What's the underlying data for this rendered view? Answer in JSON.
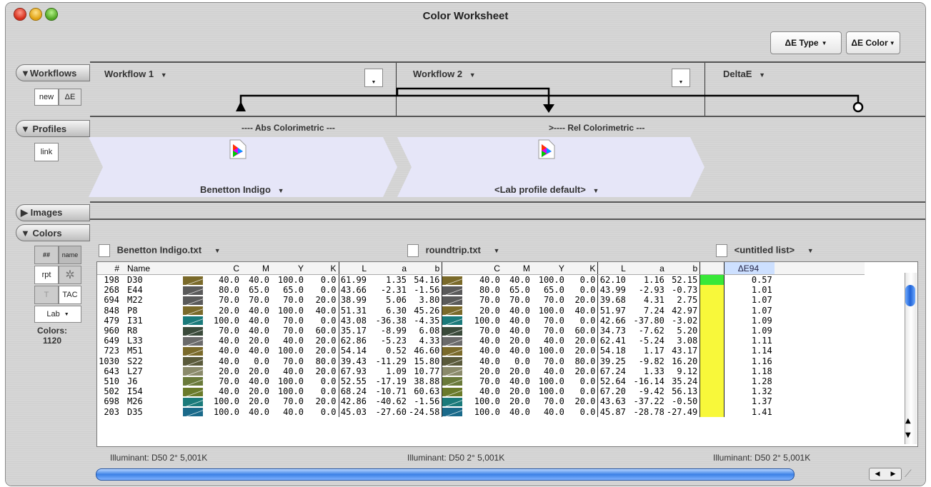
{
  "window": {
    "title": "Color Worksheet"
  },
  "toolbar": {
    "de_type": "ΔE Type",
    "de_color": "ΔE Color"
  },
  "sections": {
    "workflows": "▼Workflows",
    "profiles": "▼ Profiles",
    "images": "▶ Images",
    "colors": "▼ Colors"
  },
  "workflows": {
    "new_label": "new",
    "de_label": "ΔE",
    "w1": "Workflow 1",
    "w2": "Workflow 2",
    "w3": "DeltaE",
    "dropdown_glyph": "▼"
  },
  "profiles": {
    "link_label": "link",
    "intent1": "---- Abs Colorimetric ---",
    "intent2": ">---- Rel Colorimetric ---",
    "p1": "Benetton Indigo",
    "p2": "<Lab profile default>"
  },
  "colors_side": {
    "num_btn": "##",
    "name_btn": "name",
    "rpt_btn": "rpt",
    "t_btn": "T",
    "tac_btn": "TAC",
    "lab_btn": "Lab",
    "count_label": "Colors:",
    "count_value": "1120"
  },
  "lists": {
    "l1": "Benetton Indigo.txt",
    "l2": "roundtrip.txt",
    "l3": "<untitled list>"
  },
  "table": {
    "headers": [
      "#",
      "Name",
      "C",
      "M",
      "Y",
      "K",
      "L",
      "a",
      "b",
      "C",
      "M",
      "Y",
      "K",
      "L",
      "a",
      "b",
      "ΔE94"
    ],
    "swatch_colors": [
      "#7a6a2a",
      "#5a5a5a",
      "#5a5a5a",
      "#7a6a2a",
      "#1a7a7a",
      "#3a4a3a",
      "#6a6a6a",
      "#7a6a2a",
      "#5a5a3a",
      "#8a8a6a",
      "#6a7a3a",
      "#6a7a2a",
      "#1a7a7a",
      "#1a6a8a"
    ],
    "rows": [
      [
        "198",
        "D30",
        "40.0",
        "40.0",
        "100.0",
        "0.0",
        "61.99",
        "1.35",
        "54.16",
        "40.0",
        "40.0",
        "100.0",
        "0.0",
        "62.10",
        "1.16",
        "52.15",
        "0.57"
      ],
      [
        "268",
        "E44",
        "80.0",
        "65.0",
        "65.0",
        "0.0",
        "43.66",
        "-2.31",
        "-1.56",
        "80.0",
        "65.0",
        "65.0",
        "0.0",
        "43.99",
        "-2.93",
        "-0.73",
        "1.01"
      ],
      [
        "694",
        "M22",
        "70.0",
        "70.0",
        "70.0",
        "20.0",
        "38.99",
        "5.06",
        "3.80",
        "70.0",
        "70.0",
        "70.0",
        "20.0",
        "39.68",
        "4.31",
        "2.75",
        "1.07"
      ],
      [
        "848",
        "P8",
        "20.0",
        "40.0",
        "100.0",
        "40.0",
        "51.31",
        "6.30",
        "45.26",
        "20.0",
        "40.0",
        "100.0",
        "40.0",
        "51.97",
        "7.24",
        "42.97",
        "1.07"
      ],
      [
        "479",
        "I31",
        "100.0",
        "40.0",
        "70.0",
        "0.0",
        "43.08",
        "-36.38",
        "-4.35",
        "100.0",
        "40.0",
        "70.0",
        "0.0",
        "42.66",
        "-37.80",
        "-3.02",
        "1.09"
      ],
      [
        "960",
        "R8",
        "70.0",
        "40.0",
        "70.0",
        "60.0",
        "35.17",
        "-8.99",
        "6.08",
        "70.0",
        "40.0",
        "70.0",
        "60.0",
        "34.73",
        "-7.62",
        "5.20",
        "1.09"
      ],
      [
        "649",
        "L33",
        "40.0",
        "20.0",
        "40.0",
        "20.0",
        "62.86",
        "-5.23",
        "4.33",
        "40.0",
        "20.0",
        "40.0",
        "20.0",
        "62.41",
        "-5.24",
        "3.08",
        "1.11"
      ],
      [
        "723",
        "M51",
        "40.0",
        "40.0",
        "100.0",
        "20.0",
        "54.14",
        "0.52",
        "46.60",
        "40.0",
        "40.0",
        "100.0",
        "20.0",
        "54.18",
        "1.17",
        "43.17",
        "1.14"
      ],
      [
        "1030",
        "S22",
        "40.0",
        "0.0",
        "70.0",
        "80.0",
        "39.43",
        "-11.29",
        "15.80",
        "40.0",
        "0.0",
        "70.0",
        "80.0",
        "39.25",
        "-9.82",
        "16.20",
        "1.16"
      ],
      [
        "643",
        "L27",
        "20.0",
        "20.0",
        "40.0",
        "20.0",
        "67.93",
        "1.09",
        "10.77",
        "20.0",
        "20.0",
        "40.0",
        "20.0",
        "67.24",
        "1.33",
        "9.12",
        "1.18"
      ],
      [
        "510",
        "J6",
        "70.0",
        "40.0",
        "100.0",
        "0.0",
        "52.55",
        "-17.19",
        "38.88",
        "70.0",
        "40.0",
        "100.0",
        "0.0",
        "52.64",
        "-16.14",
        "35.24",
        "1.28"
      ],
      [
        "502",
        "I54",
        "40.0",
        "20.0",
        "100.0",
        "0.0",
        "68.24",
        "-10.71",
        "60.63",
        "40.0",
        "20.0",
        "100.0",
        "0.0",
        "67.20",
        "-9.42",
        "56.13",
        "1.32"
      ],
      [
        "698",
        "M26",
        "100.0",
        "20.0",
        "70.0",
        "20.0",
        "42.86",
        "-40.62",
        "-1.56",
        "100.0",
        "20.0",
        "70.0",
        "20.0",
        "43.63",
        "-37.22",
        "-0.50",
        "1.37"
      ],
      [
        "203",
        "D35",
        "100.0",
        "40.0",
        "40.0",
        "0.0",
        "45.03",
        "-27.60",
        "-24.58",
        "100.0",
        "40.0",
        "40.0",
        "0.0",
        "45.87",
        "-28.78",
        "-27.49",
        "1.41"
      ]
    ]
  },
  "footer": {
    "illum1": "Illuminant: D50 2° 5,001K",
    "illum2": "Illuminant: D50 2° 5,001K",
    "illum3": "Illuminant: D50 2° 5,001K"
  }
}
